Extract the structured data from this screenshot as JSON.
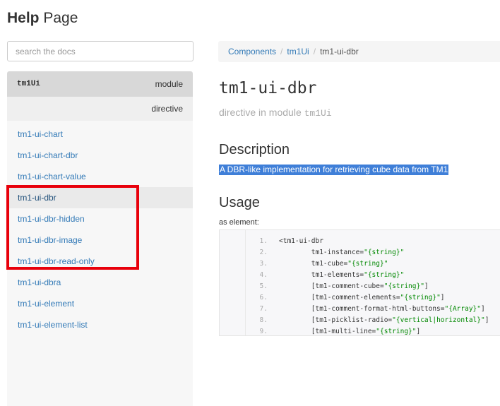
{
  "header": {
    "bold": "Help",
    "rest": " Page"
  },
  "search": {
    "placeholder": "search the docs"
  },
  "sidebar": {
    "module_name": "tm1Ui",
    "module_type": "module",
    "section": "directive",
    "items": [
      "tm1-ui-chart",
      "tm1-ui-chart-dbr",
      "tm1-ui-chart-value",
      "tm1-ui-dbr",
      "tm1-ui-dbr-hidden",
      "tm1-ui-dbr-image",
      "tm1-ui-dbr-read-only",
      "tm1-ui-dbra",
      "tm1-ui-element",
      "tm1-ui-element-list"
    ],
    "active_index": 3
  },
  "breadcrumb": {
    "items": [
      "Components",
      "tm1Ui"
    ],
    "current": "tm1-ui-dbr"
  },
  "main": {
    "title": "tm1-ui-dbr",
    "subtitle_prefix": "directive in module ",
    "subtitle_module": "tm1Ui",
    "description_heading": "Description",
    "description": "A DBR-like implementation for retrieving cube data from TM1",
    "usage_heading": "Usage",
    "as_element": "as element:",
    "code": [
      {
        "n": "1.",
        "pre": "<tm1-ui-dbr",
        "str": "",
        "post": ""
      },
      {
        "n": "2.",
        "pre": "        tm1-instance=",
        "str": "\"{string}\"",
        "post": ""
      },
      {
        "n": "3.",
        "pre": "        tm1-cube=",
        "str": "\"{string}\"",
        "post": ""
      },
      {
        "n": "4.",
        "pre": "        tm1-elements=",
        "str": "\"{string}\"",
        "post": ""
      },
      {
        "n": "5.",
        "pre": "        [tm1-comment-cube=",
        "str": "\"{string}\"",
        "post": "]"
      },
      {
        "n": "6.",
        "pre": "        [tm1-comment-elements=",
        "str": "\"{string}\"",
        "post": "]"
      },
      {
        "n": "7.",
        "pre": "        [tm1-comment-format-html-buttons=",
        "str": "\"{Array}\"",
        "post": "]"
      },
      {
        "n": "8.",
        "pre": "        [tm1-picklist-radio=",
        "str": "\"{vertical|horizontal}\"",
        "post": "]"
      },
      {
        "n": "9.",
        "pre": "        [tm1-multi-line=",
        "str": "\"{string}\"",
        "post": "]"
      }
    ]
  }
}
